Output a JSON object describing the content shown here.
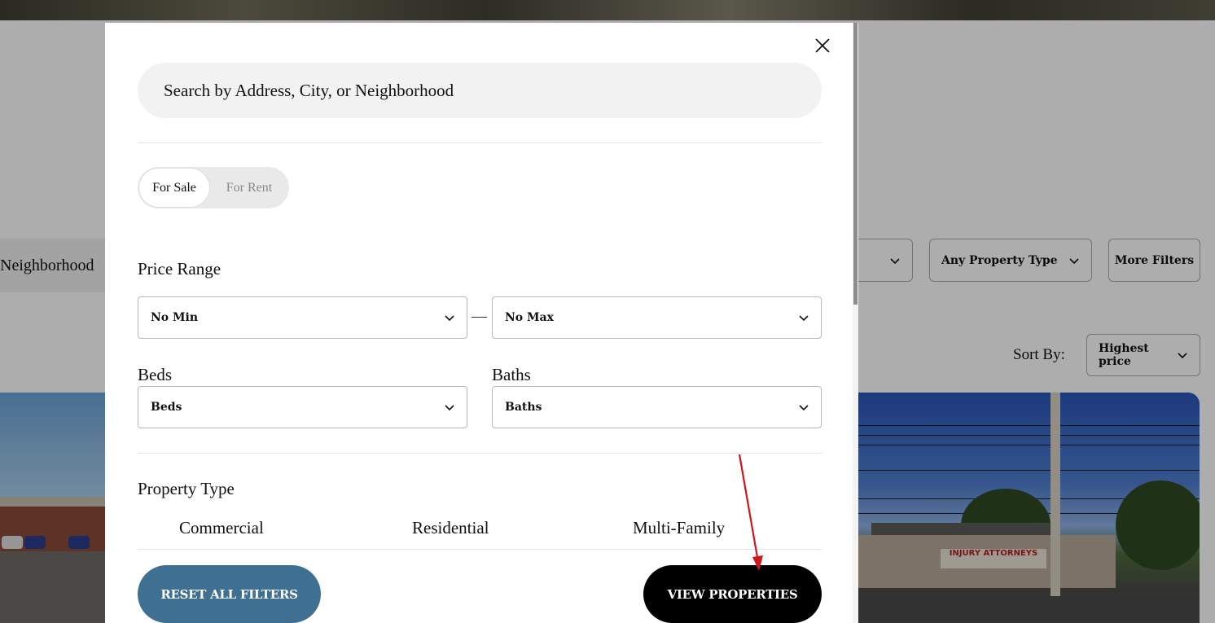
{
  "background": {
    "neighborhood_fragment": "Neighborhood",
    "filter_selects": [
      {
        "label": ""
      },
      {
        "label": "Any Property Type"
      }
    ],
    "more_filters_label": "More Filters",
    "sort": {
      "label": "Sort By:",
      "value": "Highest price"
    },
    "listing_sign_text": "INJURY ATTORNEYS"
  },
  "modal": {
    "search": {
      "placeholder": "Search by Address, City, or Neighborhood",
      "value": ""
    },
    "listing_toggle": {
      "options": [
        "For Sale",
        "For Rent"
      ],
      "selected": "For Sale"
    },
    "price_range": {
      "label": "Price Range",
      "min": "No Min",
      "max": "No Max"
    },
    "beds": {
      "label": "Beds",
      "value": "Beds"
    },
    "baths": {
      "label": "Baths",
      "value": "Baths"
    },
    "property_type": {
      "label": "Property Type",
      "options": [
        "Commercial",
        "Residential",
        "Multi-Family"
      ]
    },
    "reset_label": "RESET ALL FILTERS",
    "view_label": "VIEW PROPERTIES"
  },
  "colors": {
    "reset_button": "#3f7092",
    "view_button": "#000000",
    "annotation_arrow": "#d0161b"
  },
  "icons": {
    "close": "close-icon",
    "dropdown": "chevron-down-icon"
  }
}
